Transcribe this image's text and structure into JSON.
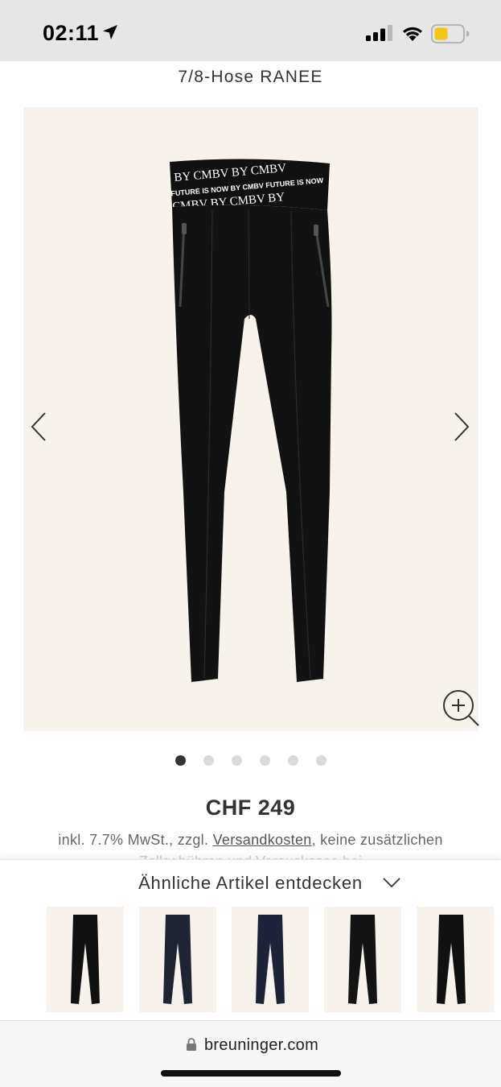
{
  "status_bar": {
    "time": "02:11",
    "location_icon": "location-arrow-icon",
    "signal_icon": "cellular-signal-icon",
    "wifi_icon": "wifi-icon",
    "battery_icon": "battery-low-icon",
    "battery_color": "#f5c518"
  },
  "product": {
    "title": "7/8-Hose RANEE",
    "waistband_text_1": "BY CMBV BY CMBV",
    "waistband_text_2": "FUTURE IS NOW BY CMBV FUTURE IS NOW",
    "waistband_text_3": "CMBV BY CMBV BY",
    "image_background": "#f7f2ec",
    "gallery": {
      "total_images": 6,
      "active_index": 0
    },
    "price": "CHF 249",
    "price_note_prefix": "inkl. 7.7% MwSt., zzgl. ",
    "price_note_link": "Versandkosten",
    "price_note_suffix": ", keine zusätzlichen",
    "price_note_line2": "Zollgebühren und Vorauskasse bei"
  },
  "similar": {
    "title": "Ähnliche Artikel entdecken",
    "chevron_icon": "chevron-down-icon",
    "items": [
      {
        "color": "#111111"
      },
      {
        "color": "#1f2433"
      },
      {
        "color": "#1c2238"
      },
      {
        "color": "#141414"
      },
      {
        "color": "#111111"
      }
    ]
  },
  "browser": {
    "url": "breuninger.com",
    "lock_icon": "lock-icon"
  }
}
